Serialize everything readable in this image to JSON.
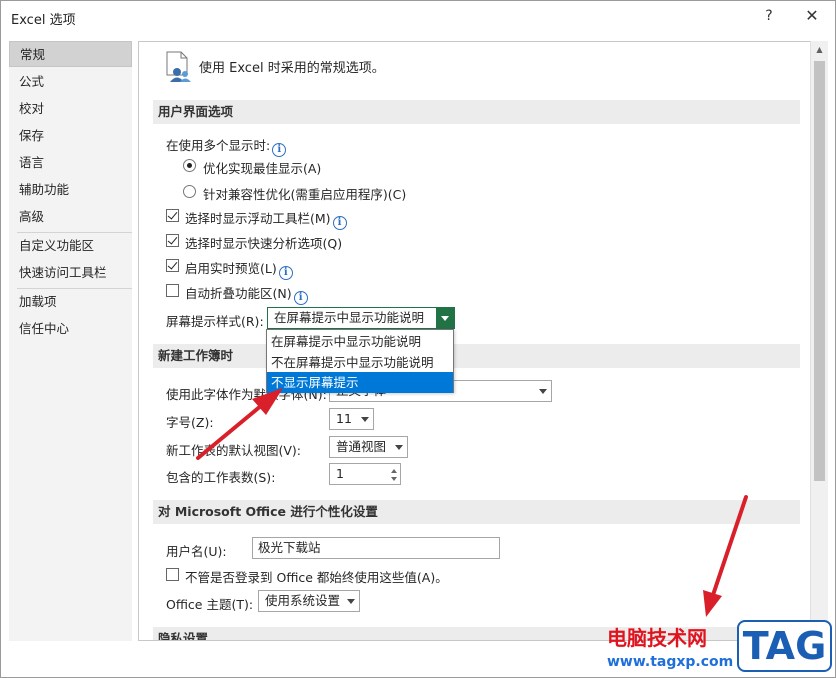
{
  "window": {
    "title": "Excel 选项",
    "help": "?",
    "close": "✕"
  },
  "sidebar": {
    "items": [
      {
        "label": "常规",
        "active": true
      },
      {
        "label": "公式"
      },
      {
        "label": "校对"
      },
      {
        "label": "保存"
      },
      {
        "label": "语言"
      },
      {
        "label": "辅助功能"
      },
      {
        "label": "高级"
      },
      {
        "label": "自定义功能区"
      },
      {
        "label": "快速访问工具栏"
      },
      {
        "label": "加载项"
      },
      {
        "label": "信任中心"
      }
    ]
  },
  "main": {
    "header": "使用 Excel 时采用的常规选项。",
    "ui_options": {
      "section_title": "用户界面选项",
      "multi_display_label": "在使用多个显示时:",
      "radio_best": "优化实现最佳显示(A)",
      "radio_compat": "针对兼容性优化(需重启应用程序)(C)",
      "chk_mini_toolbar": "选择时显示浮动工具栏(M)",
      "chk_quick_analysis": "选择时显示快速分析选项(Q)",
      "chk_live_preview": "启用实时预览(L)",
      "chk_collapse_ribbon": "自动折叠功能区(N)",
      "screentip_label": "屏幕提示样式(R):",
      "screentip_value": "在屏幕提示中显示功能说明",
      "screentip_options": [
        "在屏幕提示中显示功能说明",
        "不在屏幕提示中显示功能说明",
        "不显示屏幕提示"
      ]
    },
    "new_workbook": {
      "section_title": "新建工作簿时",
      "font_label": "使用此字体作为默认字体(N):",
      "font_value": "正文字体",
      "size_label": "字号(Z):",
      "size_value": "11",
      "view_label": "新工作表的默认视图(V):",
      "view_value": "普通视图",
      "sheets_label": "包含的工作表数(S):",
      "sheets_value": "1"
    },
    "personalize": {
      "section_title": "对 Microsoft Office 进行个性化设置",
      "username_label": "用户名(U):",
      "username_value": "极光下载站",
      "always_use_label": "不管是否登录到 Office 都始终使用这些值(A)。",
      "theme_label": "Office 主题(T):",
      "theme_value": "使用系统设置"
    },
    "privacy": {
      "section_title": "隐私设置"
    }
  },
  "watermark": {
    "site_name": "电脑技术网",
    "url": "www.tagxp.com",
    "tag": "TAG"
  },
  "colors": {
    "accent_green": "#217346",
    "selection_blue": "#0078d7",
    "arrow_red": "#d9202a"
  }
}
